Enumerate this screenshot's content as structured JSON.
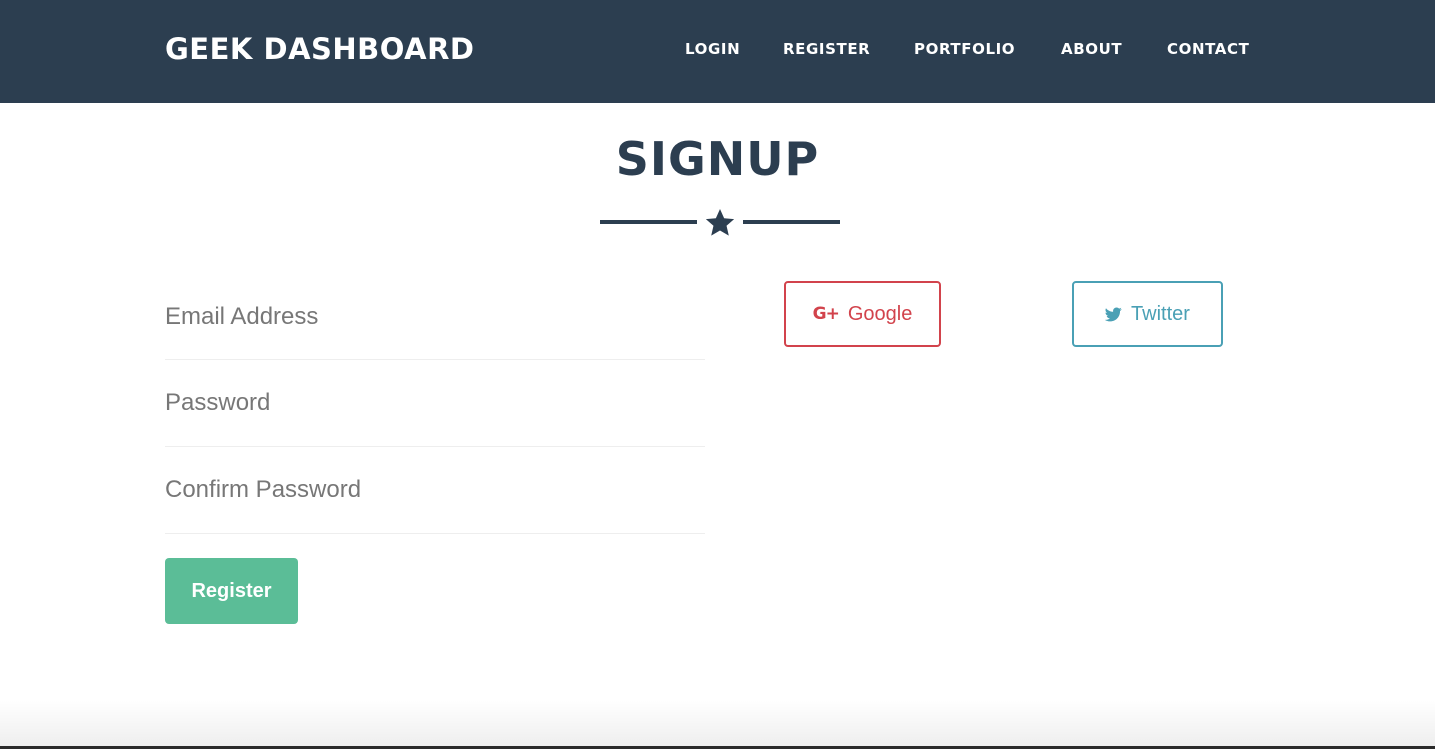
{
  "navbar": {
    "brand": "GEEK DASHBOARD",
    "items": [
      {
        "label": "LOGIN"
      },
      {
        "label": "REGISTER"
      },
      {
        "label": "PORTFOLIO"
      },
      {
        "label": "ABOUT"
      },
      {
        "label": "CONTACT"
      }
    ],
    "background_color": "#2c3e50"
  },
  "main": {
    "title": "SIGNUP",
    "divider_icon": "star-icon",
    "form": {
      "email": {
        "placeholder": "Email Address",
        "value": ""
      },
      "password": {
        "placeholder": "Password",
        "value": ""
      },
      "confirm_password": {
        "placeholder": "Confirm Password",
        "value": ""
      },
      "register_label": "Register",
      "register_color": "#5bbd97"
    },
    "social": {
      "google": {
        "label": "Google",
        "icon": "google-plus-icon",
        "color": "#d2434c"
      },
      "twitter": {
        "label": "Twitter",
        "icon": "twitter-icon",
        "color": "#4aa0b5"
      }
    }
  }
}
